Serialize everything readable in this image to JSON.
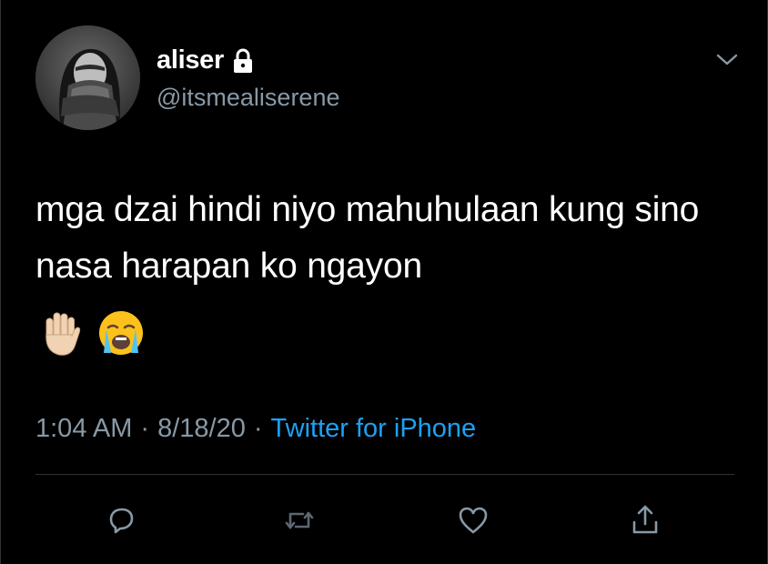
{
  "user": {
    "display_name": "aliser",
    "handle": "@itsmealiserene",
    "protected_icon": "lock-icon",
    "avatar_icon": "profile-photo"
  },
  "tweet": {
    "text": "mga dzai hindi niyo mahuhulaan kung sino nasa harapan ko ngayon",
    "emojis": [
      "raised-hand-emoji",
      "loudly-crying-face-emoji"
    ]
  },
  "meta": {
    "time": "1:04 AM",
    "separator": "·",
    "date": "8/18/20",
    "source": "Twitter for iPhone"
  },
  "actions": {
    "reply_icon": "reply-icon",
    "retweet_icon": "retweet-icon",
    "like_icon": "heart-icon",
    "share_icon": "share-icon",
    "menu_icon": "chevron-down-icon"
  },
  "colors": {
    "background": "#000000",
    "text": "#ffffff",
    "secondary_text": "#8899a6",
    "link": "#1da1f2",
    "divider": "#2f3336"
  }
}
